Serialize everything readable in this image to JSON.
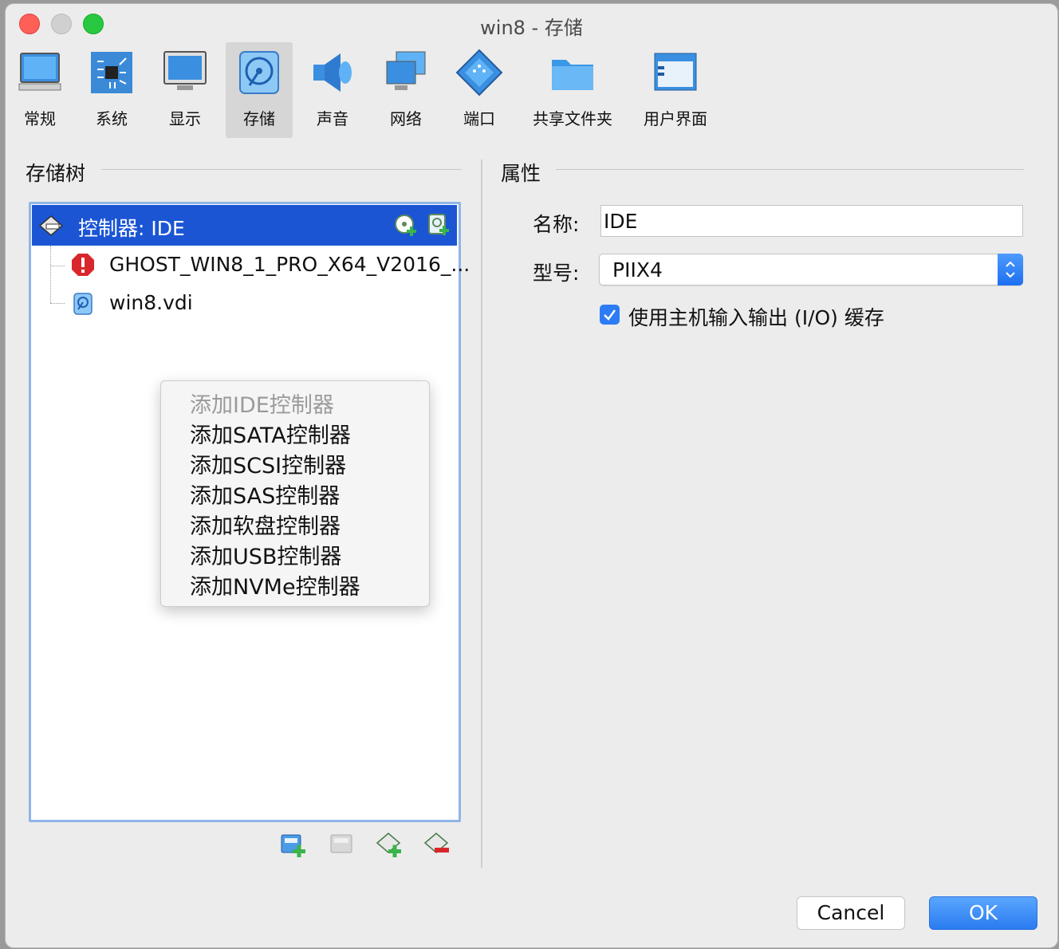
{
  "window": {
    "title": "win8 - 存储"
  },
  "toolbar": {
    "items": [
      {
        "label": "常规",
        "icon": "monitor-icon"
      },
      {
        "label": "系统",
        "icon": "chip-icon"
      },
      {
        "label": "显示",
        "icon": "display-icon"
      },
      {
        "label": "存储",
        "icon": "disk-icon",
        "active": true
      },
      {
        "label": "声音",
        "icon": "speaker-icon"
      },
      {
        "label": "网络",
        "icon": "network-icon"
      },
      {
        "label": "端口",
        "icon": "serial-port-icon"
      },
      {
        "label": "共享文件夹",
        "icon": "folder-icon"
      },
      {
        "label": "用户界面",
        "icon": "window-ui-icon"
      }
    ]
  },
  "storage_tree": {
    "title": "存储树",
    "controller_label": "控制器: IDE",
    "children": [
      {
        "label": "GHOST_WIN8_1_PRO_X64_V2016_...",
        "icon": "error-icon"
      },
      {
        "label": "win8.vdi",
        "icon": "hard-disk-icon"
      }
    ]
  },
  "context_menu": {
    "items": [
      {
        "label": "添加IDE控制器",
        "disabled": true
      },
      {
        "label": "添加SATA控制器"
      },
      {
        "label": "添加SCSI控制器"
      },
      {
        "label": "添加SAS控制器"
      },
      {
        "label": "添加软盘控制器"
      },
      {
        "label": "添加USB控制器"
      },
      {
        "label": "添加NVMe控制器"
      }
    ]
  },
  "attributes": {
    "title": "属性",
    "name_label": "名称:",
    "name_value": "IDE",
    "type_label": "型号:",
    "type_value": "PIIX4",
    "host_io_cache_label": "使用主机输入输出 (I/O) 缓存",
    "host_io_cache_checked": true
  },
  "buttons": {
    "cancel": "Cancel",
    "ok": "OK"
  },
  "colors": {
    "selection": "#1b55d4",
    "accent": "#2d7cf6"
  }
}
